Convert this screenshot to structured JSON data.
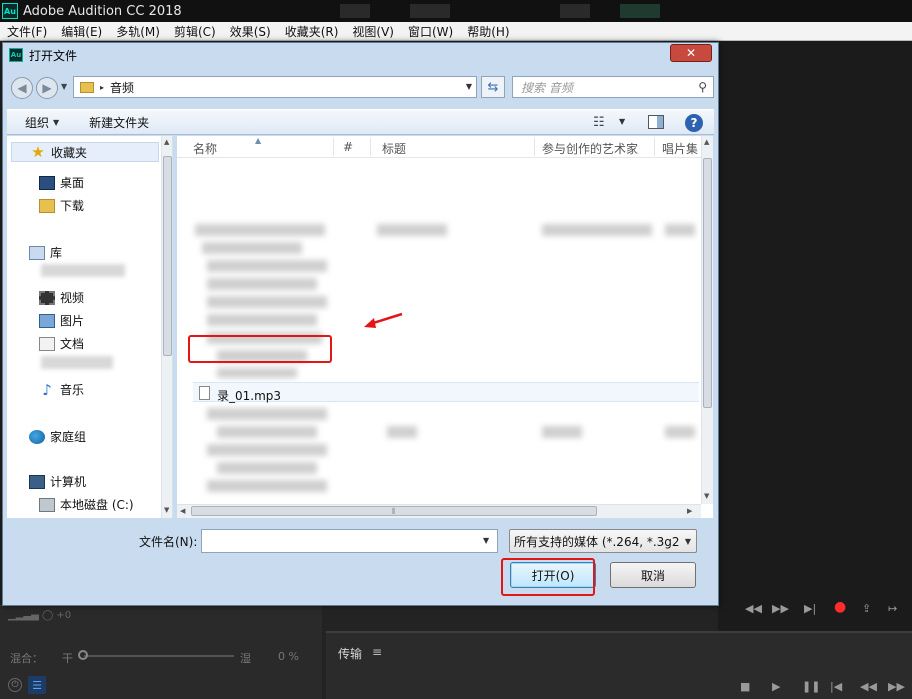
{
  "app": {
    "title": "Adobe Audition CC 2018",
    "logo": "Au",
    "menu": [
      "文件(F)",
      "编辑(E)",
      "多轨(M)",
      "剪辑(C)",
      "效果(S)",
      "收藏夹(R)",
      "视图(V)",
      "窗口(W)",
      "帮助(H)"
    ]
  },
  "dialog": {
    "title": "打开文件",
    "close_glyph": "✕",
    "address": {
      "path": "音频",
      "separator": "▸"
    },
    "search_placeholder": "搜索 音频",
    "toolbar": {
      "organize": "组织",
      "new_folder": "新建文件夹"
    },
    "nav": {
      "favorites": "收藏夹",
      "desktop": "桌面",
      "downloads": "下载",
      "libraries": "库",
      "videos": "视频",
      "pictures": "图片",
      "documents": "文档",
      "music": "音乐",
      "homegroup": "家庭组",
      "computer": "计算机",
      "local_disk": "本地磁盘 (C:)"
    },
    "columns": [
      "名称",
      "#",
      "标题",
      "参与创作的艺术家",
      "唱片集"
    ],
    "selected_file": "录_01.mp3",
    "filename_label": "文件名(N):",
    "filename_value": "",
    "filetype": "所有支持的媒体 (*.264, *.3g2,",
    "open_button": "打开(O)",
    "cancel_button": "取消"
  },
  "panels": {
    "transport_label": "传输",
    "mix_label": "混合：",
    "mix_dry": "干",
    "mix_wet": "湿",
    "mix_percent": "0 %"
  },
  "colors": {
    "highlight": "#e31616",
    "app_accent": "#00e4c4"
  }
}
